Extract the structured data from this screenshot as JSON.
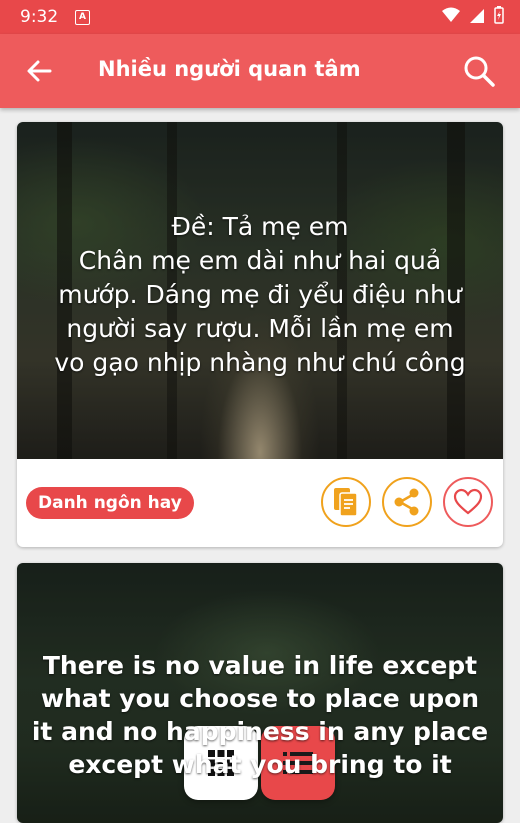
{
  "status_bar": {
    "time": "9:32",
    "notification_icon": "a-box-icon",
    "icons": [
      "wifi-icon",
      "signal-icon",
      "battery-charging-icon"
    ]
  },
  "app_bar": {
    "title": "Nhiều người quan tâm",
    "back_icon": "arrow-back-icon",
    "search_icon": "search-icon",
    "color": "#ee5b5c"
  },
  "cards": [
    {
      "quote": "Đề: Tả mẹ em\nChân mẹ em dài như hai quả\nmướp. Dáng mẹ đi yểu điệu như\nngười say rượu. Mỗi lần mẹ em\nvo gạo nhịp nhàng như chú công",
      "tag": "Danh ngôn hay",
      "actions": [
        "copy-icon",
        "share-icon",
        "heart-icon"
      ]
    },
    {
      "quote": "There is no value in life except\nwhat you choose to place upon\nit and no happiness in any place\nexcept what you bring to it"
    }
  ],
  "fabs": [
    "grid-icon",
    "list-icon"
  ],
  "colors": {
    "accent": "#e8484a",
    "action_border": "#f0a21d"
  }
}
